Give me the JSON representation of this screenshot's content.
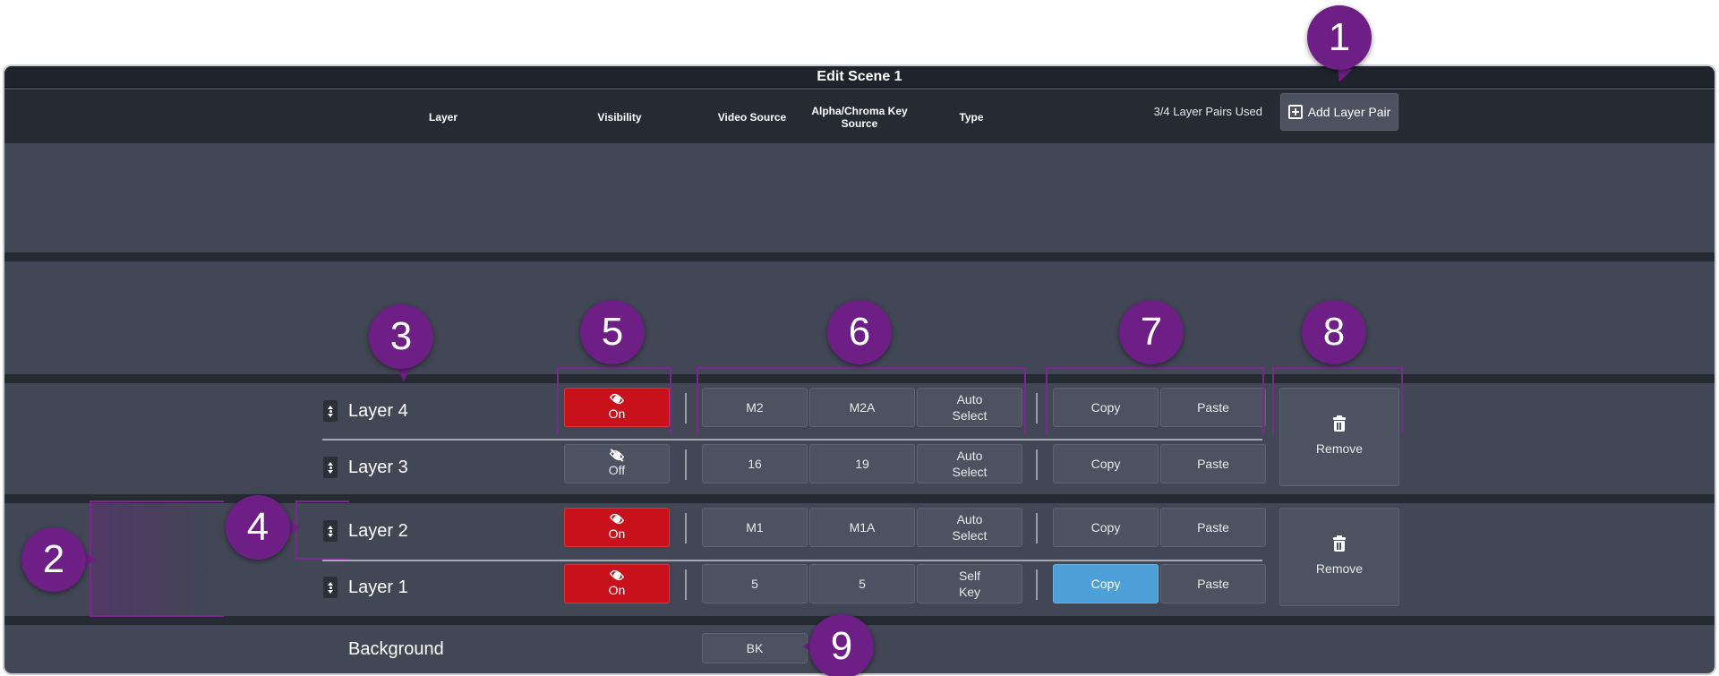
{
  "window": {
    "title": "Edit Scene 1"
  },
  "header": {
    "columns": {
      "layer": "Layer",
      "visibility": "Visibility",
      "video_source": "Video Source",
      "alpha_line1": "Alpha/Chroma Key",
      "alpha_line2": "Source",
      "type": "Type"
    },
    "pairs_used": "3/4 Layer Pairs Used",
    "add_layer_pair": "Add Layer Pair"
  },
  "layers": [
    {
      "name": "Layer 4",
      "visibility": "On",
      "video": "M2",
      "alpha": "M2A",
      "type_line1": "Auto",
      "type_line2": "Select",
      "copy": "Copy",
      "paste": "Paste"
    },
    {
      "name": "Layer 3",
      "visibility": "Off",
      "video": "16",
      "alpha": "19",
      "type_line1": "Auto",
      "type_line2": "Select",
      "copy": "Copy",
      "paste": "Paste"
    },
    {
      "name": "Layer 2",
      "visibility": "On",
      "video": "M1",
      "alpha": "M1A",
      "type_line1": "Auto",
      "type_line2": "Select",
      "copy": "Copy",
      "paste": "Paste"
    },
    {
      "name": "Layer 1",
      "visibility": "On",
      "video": "5",
      "alpha": "5",
      "type_line1": "Self",
      "type_line2": "Key",
      "copy": "Copy",
      "paste": "Paste"
    }
  ],
  "pairs": [
    {
      "remove": "Remove"
    },
    {
      "remove": "Remove"
    }
  ],
  "background": {
    "label": "Background",
    "source": "BK"
  },
  "callouts": [
    "1",
    "2",
    "3",
    "4",
    "5",
    "6",
    "7",
    "8",
    "9"
  ],
  "colors": {
    "accent": "#6e1f86",
    "visibility_on": "#c8111b",
    "copy_active": "#4d9fd8"
  }
}
